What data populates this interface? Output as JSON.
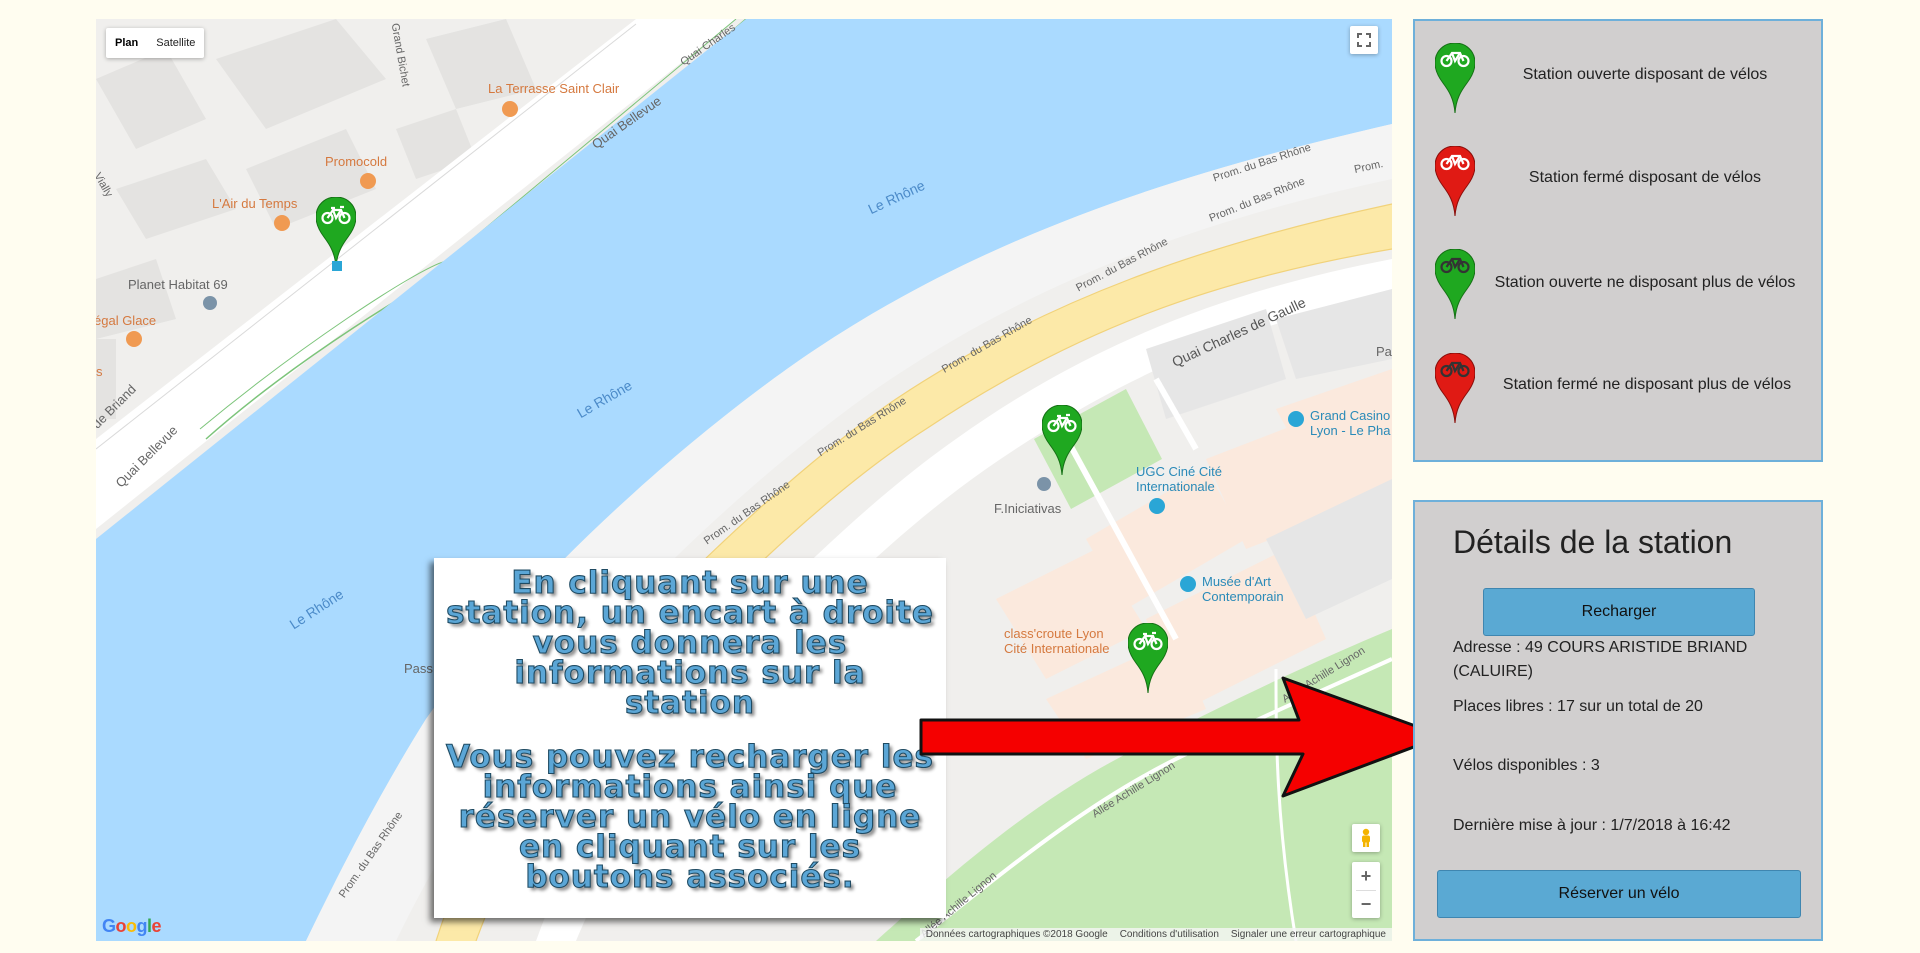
{
  "map": {
    "type_plan": "Plan",
    "type_satellite": "Satellite",
    "labels": {
      "rhone_1": "Le Rhône",
      "rhone_2": "Le Rhône",
      "rhone_3": "Le Rhône",
      "quai_bellevue_1": "Quai Bellevue",
      "quai_bellevue_2": "Quai Bellevue",
      "quai_charles_de_gaulle": "Quai Charles de Gaulle",
      "quai_charles_top": "Quai Charles",
      "de_briand": "de Briand",
      "bichet": "Grand Bichet",
      "vially": "Vially",
      "prom_1": "Prom. du Bas Rhône",
      "prom_2": "Prom. du Bas Rhône",
      "prom_3": "Prom. du Bas Rhône",
      "prom_4": "Prom. du Bas Rhône",
      "prom_5": "Prom. du Bas Rhône",
      "prom_6": "Prom. du Bas Rhône",
      "prom_7": "Prom. du Bas Rhône",
      "prom_8": "Prom.",
      "allee_1": "Allée Achille Lignon",
      "allee_2": "Allée Achille Lignon",
      "allee_3": "Allée Achille Lignon",
      "la_terrasse": "La Terrasse Saint Clair",
      "promocold": "Promocold",
      "air_du_temps": "L'Air du Temps",
      "planet_habitat": "Planet Habitat 69",
      "egal_glace": "égal Glace",
      "grand_casino": "Grand Casino",
      "lyon_le_pha": "Lyon - Le Pha",
      "ugc_1": "UGC Ciné Cité",
      "ugc_2": "Internationale",
      "f_iniciativas": "F.Iniciativas",
      "musee_1": "Musée d'Art",
      "musee_2": "Contemporain",
      "classcroute_1": "class'croute Lyon",
      "classcroute_2": "Cité Internationale",
      "pass": "Pass",
      "pa": "Pa",
      "s_left": "s"
    },
    "attribution": [
      "Données cartographiques ©2018 Google",
      "Conditions d'utilisation",
      "Signaler une erreur cartographique"
    ],
    "google": "Google"
  },
  "infobox": {
    "paragraph_1": "En cliquant sur une station, un encart à droite vous donnera les informations sur la station",
    "paragraph_2": "Vous pouvez recharger les informations ainsi que réserver un vélo en ligne en cliquant sur les boutons associés."
  },
  "legend": [
    {
      "label": "Station ouverte disposant de vélos",
      "color": "#1fa820",
      "icon": "bike-icon-white"
    },
    {
      "label": "Station fermé disposant de vélos",
      "color": "#e01a14",
      "icon": "bike-icon-white"
    },
    {
      "label": "Station ouverte ne disposant plus de vélos",
      "color": "#1fa820",
      "icon": "bike-icon-dark"
    },
    {
      "label": "Station fermé ne disposant plus de vélos",
      "color": "#e01a14",
      "icon": "bike-icon-dark"
    }
  ],
  "details": {
    "title": "Détails de la station",
    "reload_label": "Recharger",
    "address": "Adresse : 49 COURS ARISTIDE BRIAND (CALUIRE)",
    "places": "Places libres : 17 sur un total de 20",
    "bikes": "Vélos disponibles : 3",
    "updated": "Dernière mise à jour : 1/7/2018 à 16:42",
    "reserve_label": "Réserver un vélo"
  },
  "colors": {
    "river": "#aadaff",
    "panel_bg": "#d1cfcf",
    "panel_border": "#6eb0da",
    "button": "#5aa9d3",
    "arrow": "#f50000",
    "page_bg": "#fffdf0"
  }
}
